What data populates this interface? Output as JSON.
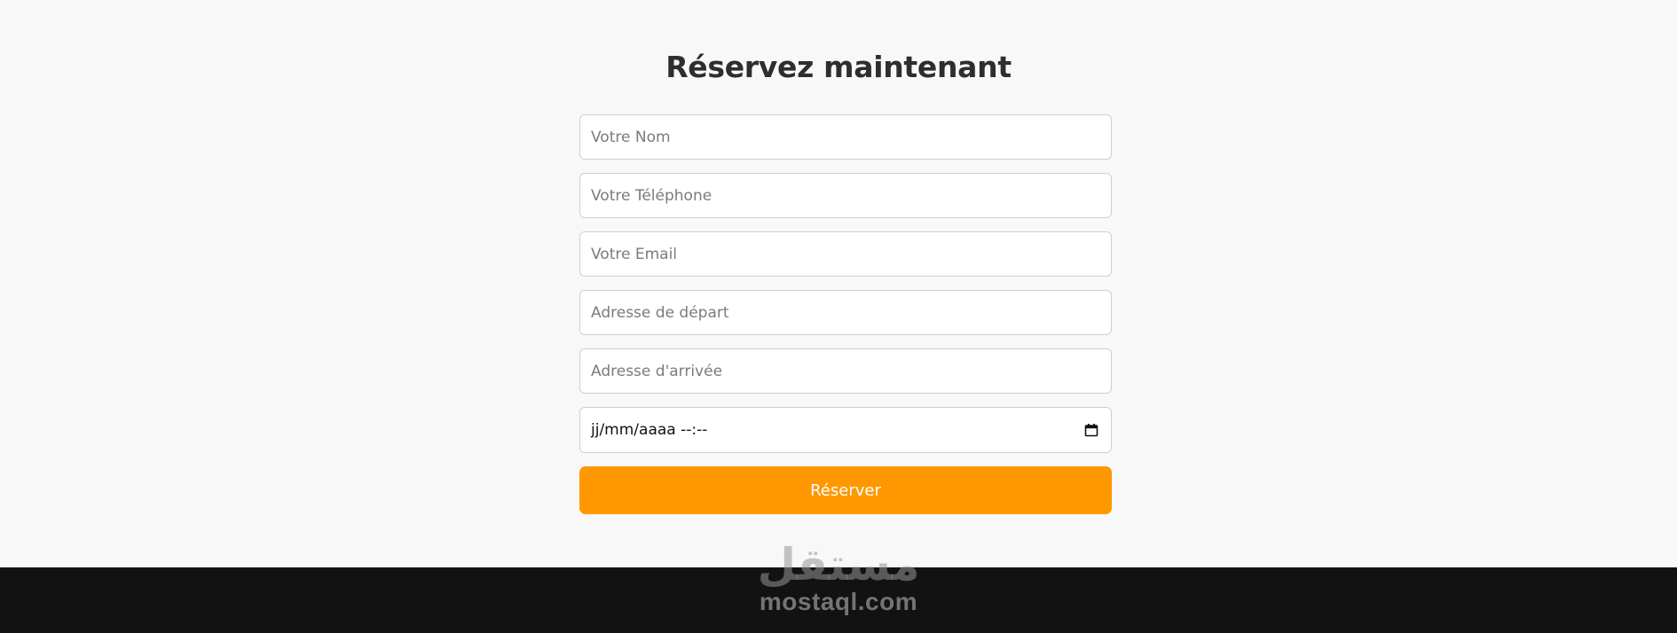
{
  "booking": {
    "title": "Réservez maintenant",
    "fields": {
      "name": {
        "placeholder": "Votre Nom",
        "value": ""
      },
      "phone": {
        "placeholder": "Votre Téléphone",
        "value": ""
      },
      "email": {
        "placeholder": "Votre Email",
        "value": ""
      },
      "departure": {
        "placeholder": "Adresse de départ",
        "value": ""
      },
      "arrival": {
        "placeholder": "Adresse d'arrivée",
        "value": ""
      },
      "datetime": {
        "display": "jj/mm/aaaa --:--",
        "icon": "calendar-icon"
      }
    },
    "submit_label": "Réserver",
    "accent_color": "#ff9800"
  },
  "watermark": {
    "arabic": "مستقل",
    "latin": "mostaql.com"
  }
}
